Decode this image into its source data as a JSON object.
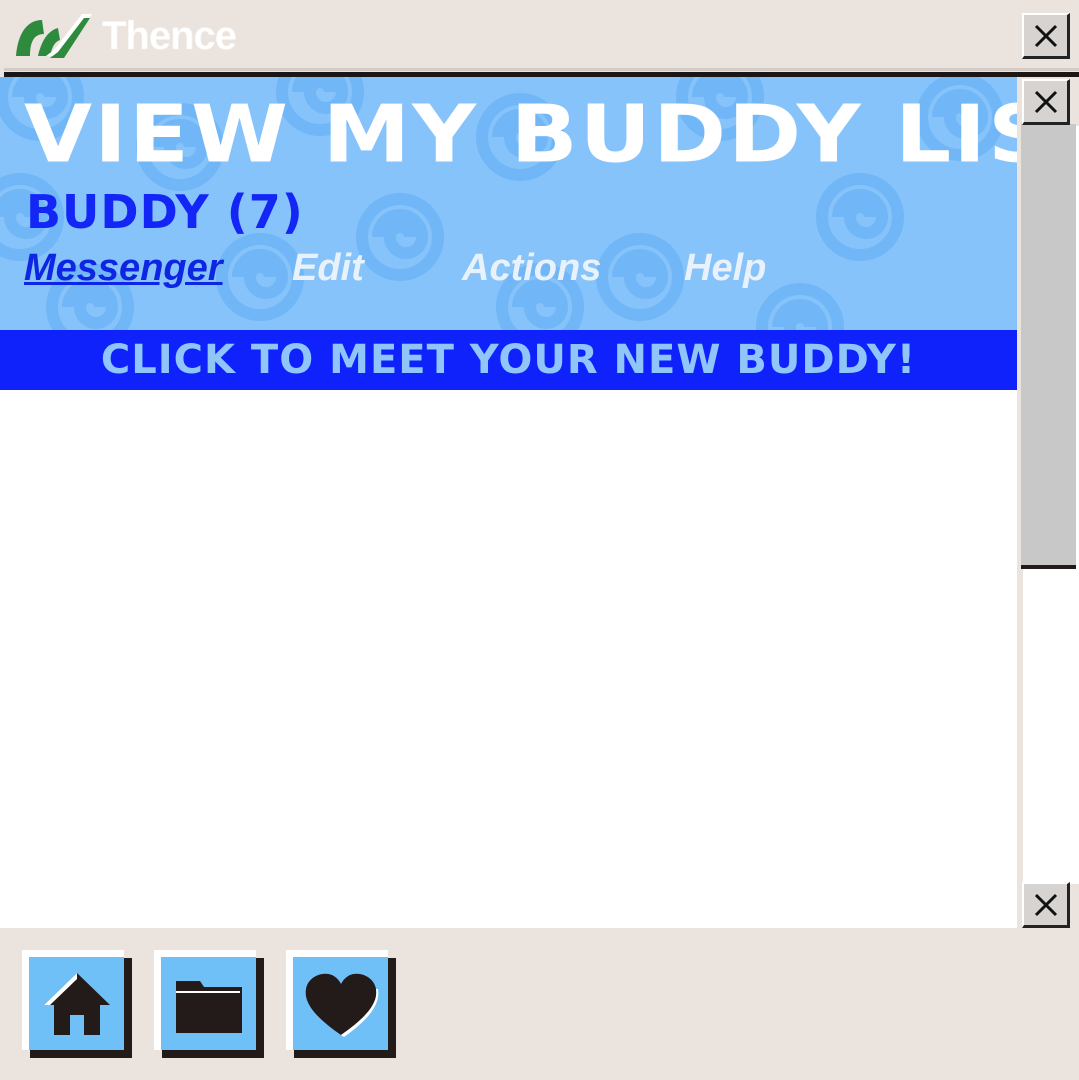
{
  "window": {
    "app_title": "Thence"
  },
  "header": {
    "heading": "View My Buddy List",
    "buddy_count": "Buddy (7)"
  },
  "menu": {
    "items": [
      {
        "label": "Messenger",
        "active": true
      },
      {
        "label": "Edit",
        "active": false
      },
      {
        "label": "Actions",
        "active": false
      },
      {
        "label": "Help",
        "active": false
      }
    ]
  },
  "banner": {
    "text": "Click to meet your new buddy!"
  },
  "toolbar": {
    "items": [
      "home-icon",
      "folder-icon",
      "heart-icon"
    ]
  },
  "colors": {
    "header_bg": "#86c3fa",
    "banner_bg": "#0f22fb",
    "accent_blue": "#1426f5",
    "chrome": "#ebe3dd",
    "logo_green": "#2f8a3c"
  }
}
